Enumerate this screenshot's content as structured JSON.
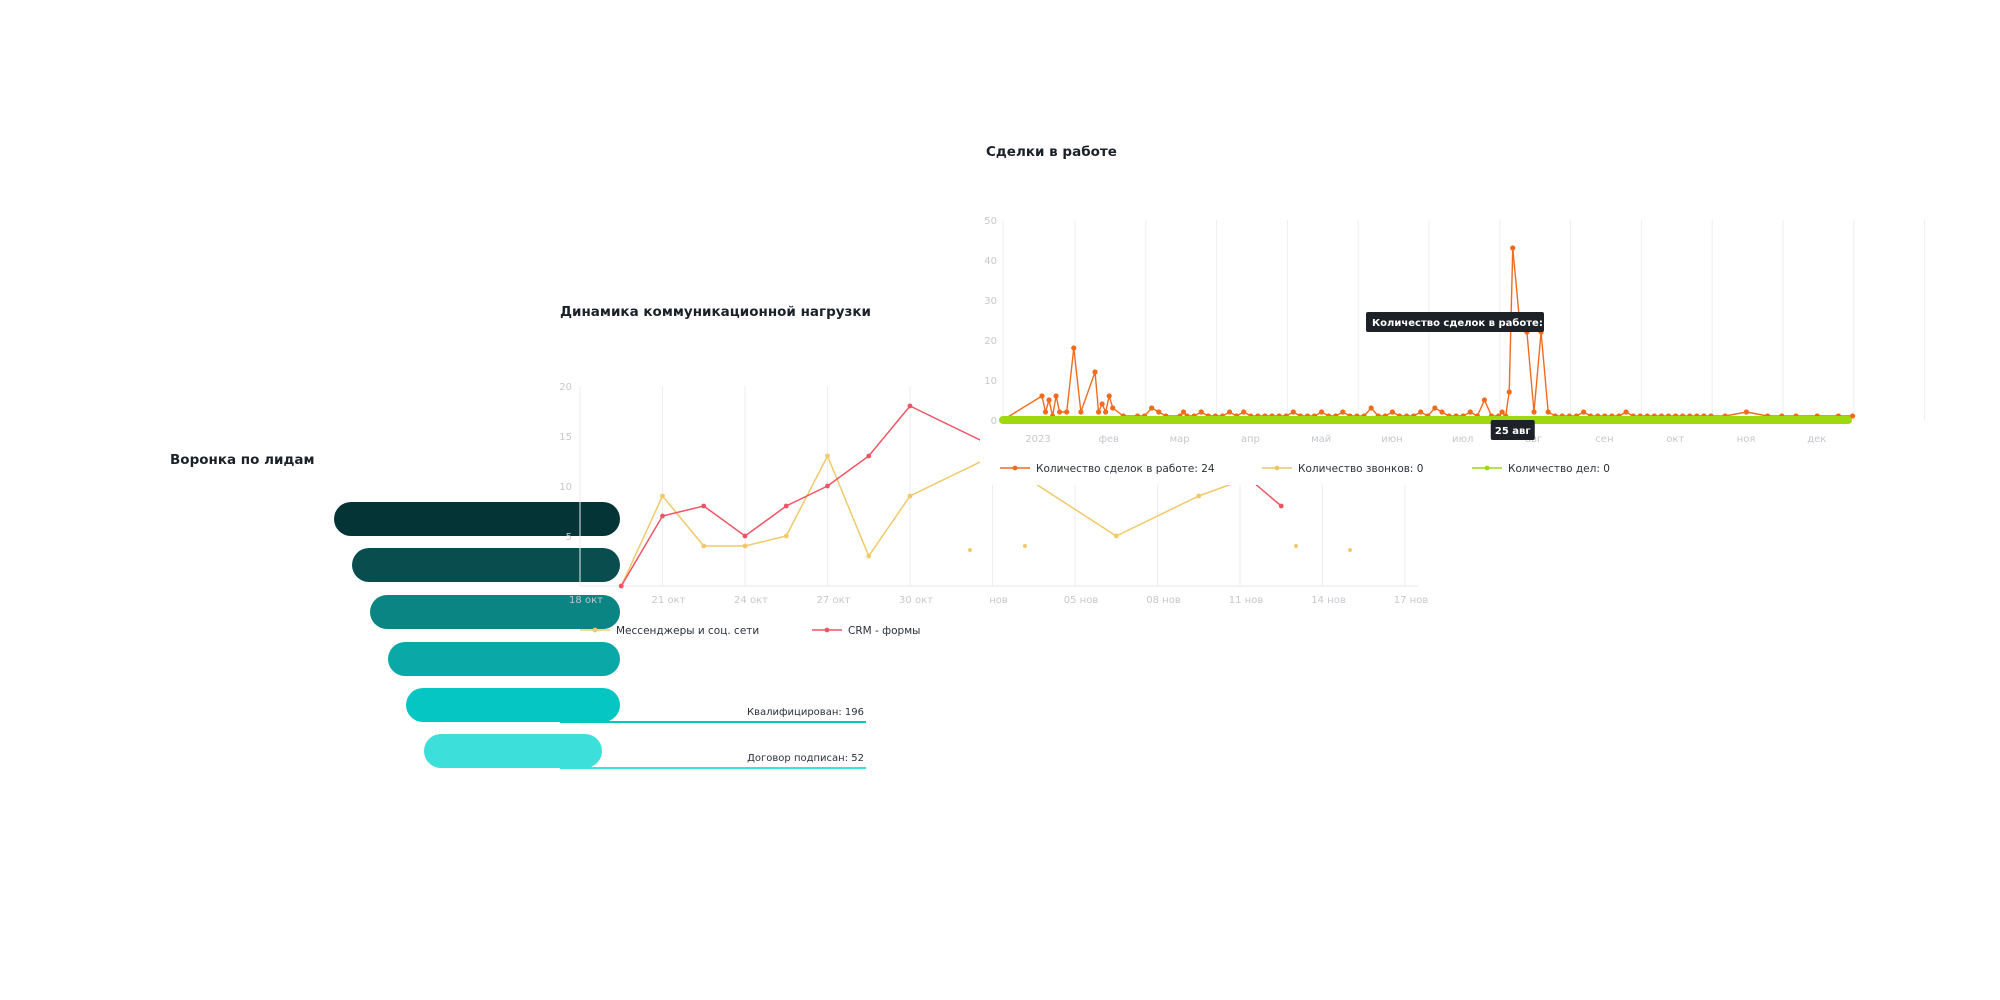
{
  "funnel": {
    "title": "Воронка по лидам",
    "stages": [
      {
        "label": "",
        "color": "#043436"
      },
      {
        "label": "",
        "color": "#0a4d4f"
      },
      {
        "label": "",
        "color": "#0b8583"
      },
      {
        "label": "",
        "color": "#0aa9a8"
      },
      {
        "label": "Квалифицирован: 196",
        "color": "#06c6c3"
      },
      {
        "label": "Договор подписан: 52",
        "color": "#3ddfdb"
      }
    ]
  },
  "comm": {
    "title": "Динамика коммуникационной нагрузки",
    "chart_data": {
      "type": "line",
      "title": "Динамика коммуникационной нагрузки",
      "ylim": [
        0,
        20
      ],
      "yticks": [
        5,
        10,
        15,
        20
      ],
      "xticks": [
        "18 окт",
        "21 окт",
        "24 окт",
        "27 окт",
        "30 окт",
        "нов",
        "05 нов",
        "08 нов",
        "11 нов",
        "14 нов",
        "17 нов"
      ],
      "series": [
        {
          "name": "Мессенджеры и соц. сети",
          "color": "#f0c96a",
          "x": [
            0.5,
            1,
            1.5,
            2,
            2.5,
            3,
            3.5,
            4,
            5,
            6.5,
            7.5,
            8.5
          ],
          "y": [
            0,
            9,
            4,
            4,
            5,
            13,
            3,
            9,
            13,
            5,
            9,
            12
          ]
        },
        {
          "name": "CRM - формы",
          "color": "#ee5463",
          "x": [
            0.5,
            1,
            1.5,
            2,
            2.5,
            3,
            3.5,
            4,
            5,
            6.5,
            7.5,
            8.5
          ],
          "y": [
            0,
            7,
            8,
            5,
            8,
            10,
            13,
            18,
            14,
            14,
            15,
            8
          ]
        }
      ]
    }
  },
  "deals": {
    "title": "Сделки в работе",
    "tooltip": "Количество сделок в работе: 24",
    "date_badge": "25 авг",
    "chart_data": {
      "type": "line",
      "title": "Сделки в работе",
      "ylim": [
        0,
        50
      ],
      "yticks": [
        0,
        10,
        20,
        30,
        40,
        50
      ],
      "xticks": [
        "2023",
        "фев",
        "мар",
        "апр",
        "май",
        "июн",
        "июл",
        "авг",
        "сен",
        "окт",
        "ноя",
        "дек"
      ],
      "series": [
        {
          "name": "Количество сделок в работе: 24",
          "color": "#f26b1d",
          "x": [
            0.55,
            0.6,
            0.65,
            0.7,
            0.75,
            0.8,
            0.9,
            1.0,
            1.1,
            1.3,
            1.35,
            1.4,
            1.45,
            1.5,
            1.55,
            1.7,
            1.9,
            2.0,
            2.1,
            2.2,
            2.3,
            2.5,
            2.55,
            2.6,
            2.7,
            2.8,
            2.9,
            3.0,
            3.1,
            3.2,
            3.3,
            3.4,
            3.5,
            3.6,
            3.7,
            3.8,
            3.9,
            4.0,
            4.1,
            4.2,
            4.3,
            4.4,
            4.5,
            4.6,
            4.7,
            4.8,
            4.9,
            5.0,
            5.1,
            5.2,
            5.3,
            5.4,
            5.5,
            5.6,
            5.7,
            5.8,
            5.9,
            6.0,
            6.1,
            6.2,
            6.3,
            6.4,
            6.5,
            6.6,
            6.7,
            6.8,
            6.9,
            7.0,
            7.05,
            7.1,
            7.15,
            7.2,
            7.3,
            7.4,
            7.5,
            7.6,
            7.7,
            7.8,
            7.9,
            8.0,
            8.1,
            8.2,
            8.3,
            8.4,
            8.5,
            8.6,
            8.7,
            8.8,
            8.9,
            9.0,
            9.1,
            9.2,
            9.3,
            9.4,
            9.5,
            9.6,
            9.7,
            9.8,
            9.9,
            10.0,
            10.2,
            10.5,
            10.8,
            11.0,
            11.2,
            11.5,
            11.8,
            12.0
          ],
          "y": [
            6,
            2,
            5,
            1,
            6,
            2,
            2,
            18,
            2,
            12,
            2,
            4,
            2,
            6,
            3,
            1,
            1,
            1,
            3,
            2,
            1,
            1,
            2,
            1,
            1,
            2,
            1,
            1,
            1,
            2,
            1,
            2,
            1,
            1,
            1,
            1,
            1,
            1,
            2,
            1,
            1,
            1,
            2,
            1,
            1,
            2,
            1,
            1,
            1,
            3,
            1,
            1,
            2,
            1,
            1,
            1,
            2,
            1,
            3,
            2,
            1,
            1,
            1,
            2,
            1,
            5,
            1,
            1,
            2,
            1,
            7,
            43,
            24,
            22,
            2,
            22,
            2,
            1,
            1,
            1,
            1,
            2,
            1,
            1,
            1,
            1,
            1,
            2,
            1,
            1,
            1,
            1,
            1,
            1,
            1,
            1,
            1,
            1,
            1,
            1,
            1,
            2,
            1,
            1,
            1,
            1,
            1,
            1
          ]
        },
        {
          "name": "Количество звонков: 0",
          "color": "#e9c66a",
          "x": [],
          "y": []
        },
        {
          "name": "Количество дел: 0",
          "color": "#9ed90f",
          "x": [],
          "y": []
        }
      ]
    }
  }
}
